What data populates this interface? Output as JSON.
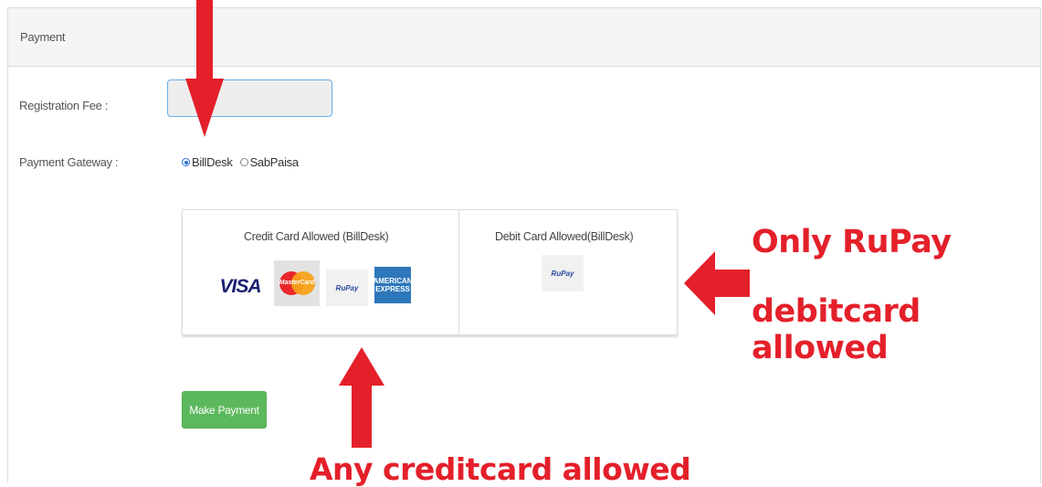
{
  "panel": {
    "title": "Payment"
  },
  "form": {
    "fee_label": "Registration Fee :",
    "fee_value": "",
    "gateway_label": "Payment Gateway :",
    "gateway_options": [
      {
        "label": "BillDesk",
        "selected": true
      },
      {
        "label": "SabPaisa",
        "selected": false
      }
    ]
  },
  "cards": {
    "credit_heading": "Credit Card Allowed (BillDesk)",
    "debit_heading": "Debit Card Allowed(BillDesk)",
    "credit_logos": [
      "visa-logo",
      "mastercard-logo",
      "rupay-logo",
      "amex-logo"
    ],
    "debit_logos": [
      "rupay-logo"
    ],
    "visa_text": "VISA",
    "mastercard_text": "MasterCard",
    "rupay_text": "RuPay",
    "amex_line1": "AMERICAN",
    "amex_line2": "EXPRESS"
  },
  "actions": {
    "make_payment": "Make Payment"
  },
  "annotations": {
    "right_line1": "Only RuPay",
    "right_line2": "debitcard allowed",
    "bottom": "Any creditcard allowed"
  },
  "colors": {
    "annotation_red": "#e4202a",
    "button_green": "#5cb85c",
    "input_focus": "#66afe9"
  }
}
